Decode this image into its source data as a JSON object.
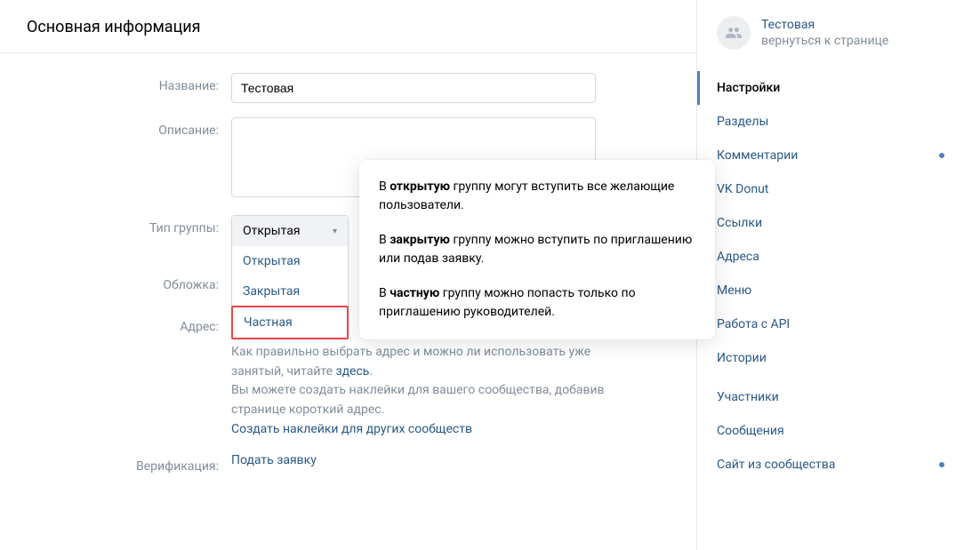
{
  "header": {
    "title": "Основная информация"
  },
  "form": {
    "name_label": "Название:",
    "name_value": "Тестовая",
    "description_label": "Описание:",
    "description_value": "",
    "type_label": "Тип группы:",
    "type_options": {
      "selected": "Открытая",
      "open": "Открытая",
      "closed": "Закрытая",
      "private": "Частная"
    },
    "cover_label": "Обложка:",
    "address_label": "Адрес:",
    "help_line1": "Как правильно выбрать адрес и можно ли использовать уже занятый, читайте ",
    "help_link": "здесь",
    "help_line2": "Вы можете создать наклейки для вашего сообщества, добавив странице короткий адрес.",
    "help_stickers_link": "Создать наклейки для других сообществ",
    "verification_label": "Верификация:",
    "verification_link": "Подать заявку"
  },
  "tooltip": {
    "p1_prefix": "В ",
    "p1_bold": "открытую",
    "p1_suffix": " группу могут вступить все желающие пользователи.",
    "p2_prefix": "В ",
    "p2_bold": "закрытую",
    "p2_suffix": " группу можно вступить по приглашению или подав заявку.",
    "p3_prefix": "В ",
    "p3_bold": "частную",
    "p3_suffix": " группу можно попасть только по приглашению руководителей."
  },
  "sidebar": {
    "group_name": "Тестовая",
    "back_text": "вернуться к странице",
    "nav": [
      {
        "label": "Настройки",
        "active": true,
        "dot": false
      },
      {
        "label": "Разделы",
        "active": false,
        "dot": false
      },
      {
        "label": "Комментарии",
        "active": false,
        "dot": true
      },
      {
        "label": "VK Donut",
        "active": false,
        "dot": false
      },
      {
        "label": "Ссылки",
        "active": false,
        "dot": false
      },
      {
        "label": "Адреса",
        "active": false,
        "dot": false
      },
      {
        "label": "Меню",
        "active": false,
        "dot": false
      },
      {
        "label": "Работа с API",
        "active": false,
        "dot": false
      },
      {
        "label": "Истории",
        "active": false,
        "dot": false
      },
      {
        "label": "Участники",
        "active": false,
        "dot": false
      },
      {
        "label": "Сообщения",
        "active": false,
        "dot": false
      },
      {
        "label": "Сайт из сообщества",
        "active": false,
        "dot": true
      }
    ]
  }
}
